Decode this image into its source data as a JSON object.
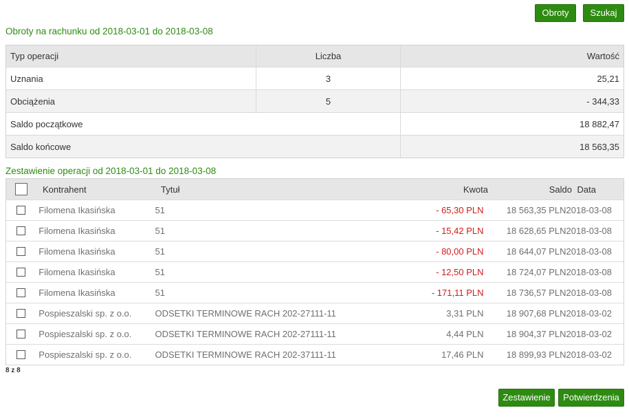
{
  "buttons": {
    "obroty": "Obroty",
    "szukaj": "Szukaj",
    "zestawienie": "Zestawienie",
    "potwierdzenia": "Potwierdzenia"
  },
  "summary": {
    "title": "Obroty na rachunku od 2018-03-01 do 2018-03-08",
    "headers": {
      "typ": "Typ operacji",
      "liczba": "Liczba",
      "wartosc": "Wartość"
    },
    "rows": [
      {
        "typ": "Uznania",
        "liczba": "3",
        "wartosc": "25,21"
      },
      {
        "typ": "Obciążenia",
        "liczba": "5",
        "wartosc": "- 344,33"
      }
    ],
    "saldo_poczatkowe": {
      "label": "Saldo początkowe",
      "value": "18 882,47"
    },
    "saldo_koncowe": {
      "label": "Saldo końcowe",
      "value": "18 563,35"
    }
  },
  "operations": {
    "title": "Zestawienie operacji od 2018-03-01 do 2018-03-08",
    "headers": {
      "kontrahent": "Kontrahent",
      "tytul": "Tytuł",
      "kwota": "Kwota",
      "saldo": "Saldo",
      "data": "Data"
    },
    "rows": [
      {
        "kontrahent": "Filomena Ikasińska",
        "tytul": "51",
        "kwota": "- 65,30 PLN",
        "saldo": "18 563,35 PLN",
        "data": "2018-03-08"
      },
      {
        "kontrahent": "Filomena Ikasińska",
        "tytul": "51",
        "kwota": "- 15,42 PLN",
        "saldo": "18 628,65 PLN",
        "data": "2018-03-08"
      },
      {
        "kontrahent": "Filomena Ikasińska",
        "tytul": "51",
        "kwota": "- 80,00 PLN",
        "saldo": "18 644,07 PLN",
        "data": "2018-03-08"
      },
      {
        "kontrahent": "Filomena Ikasińska",
        "tytul": "51",
        "kwota": "- 12,50 PLN",
        "saldo": "18 724,07 PLN",
        "data": "2018-03-08"
      },
      {
        "kontrahent": "Filomena Ikasińska",
        "tytul": "51",
        "kwota": "- 171,11 PLN",
        "saldo": "18 736,57 PLN",
        "data": "2018-03-08"
      },
      {
        "kontrahent": "Pospieszalski sp. z o.o.",
        "tytul": "ODSETKI TERMINOWE RACH 202-27111-11",
        "kwota": "3,31 PLN",
        "saldo": "18 907,68 PLN",
        "data": "2018-03-02"
      },
      {
        "kontrahent": "Pospieszalski sp. z o.o.",
        "tytul": "ODSETKI TERMINOWE RACH 202-27111-11",
        "kwota": "4,44 PLN",
        "saldo": "18 904,37 PLN",
        "data": "2018-03-02"
      },
      {
        "kontrahent": "Pospieszalski sp. z o.o.",
        "tytul": "ODSETKI TERMINOWE RACH 202-37111-11",
        "kwota": "17,46 PLN",
        "saldo": "18 899,93 PLN",
        "data": "2018-03-02"
      }
    ],
    "count": "8 z 8"
  },
  "colors": {
    "accent": "#2e8b12",
    "negative": "#d11a1a",
    "header_bg": "#e6e6e6"
  }
}
